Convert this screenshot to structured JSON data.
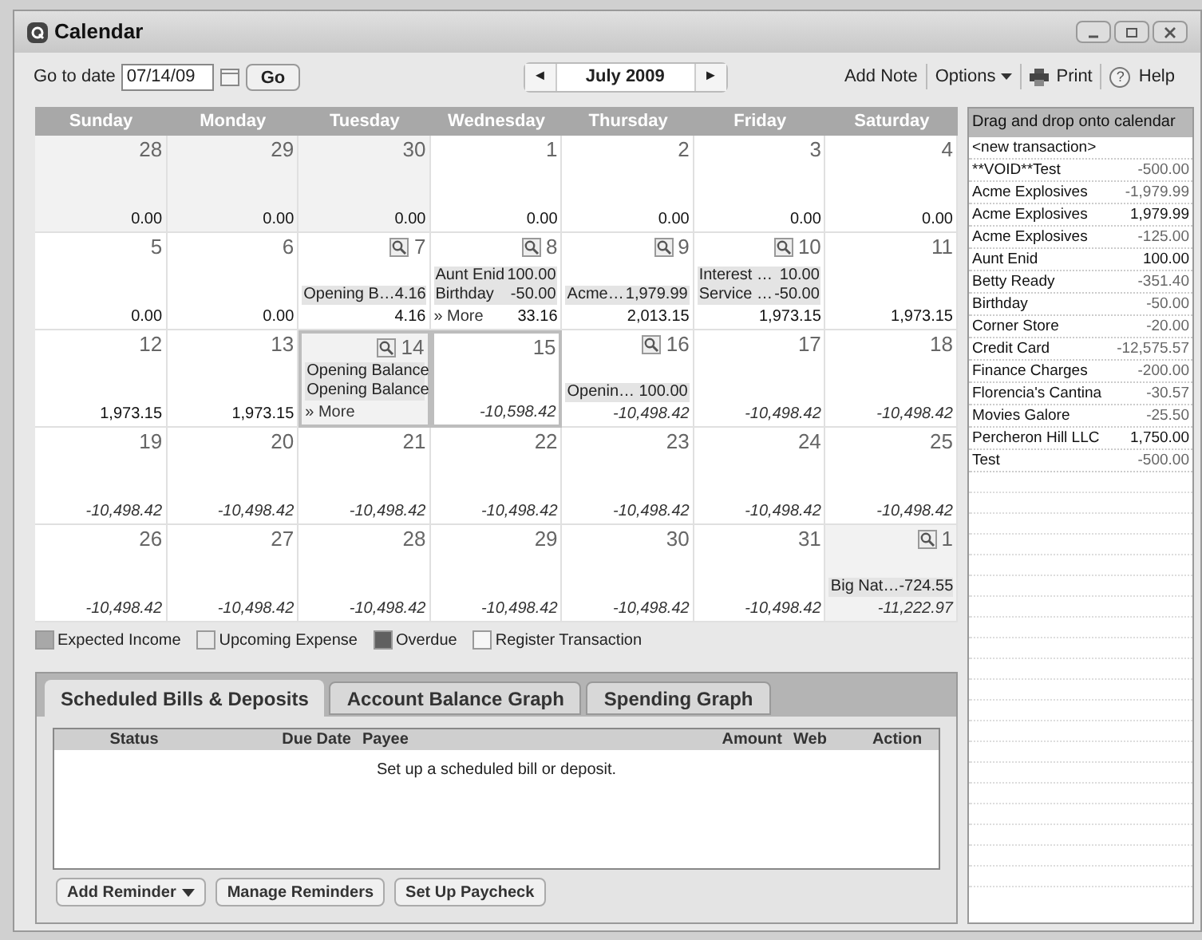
{
  "window": {
    "title": "Calendar"
  },
  "toolbar": {
    "goto_label": "Go to date",
    "goto_value": "07/14/09",
    "go_button": "Go",
    "prev": "◄",
    "month": "July 2009",
    "next": "►",
    "add_note": "Add Note",
    "options": "Options",
    "help_mark": "?",
    "print": "Print",
    "help": "Help"
  },
  "weekdays": [
    "Sunday",
    "Monday",
    "Tuesday",
    "Wednesday",
    "Thursday",
    "Friday",
    "Saturday"
  ],
  "weeks": [
    [
      {
        "day": "28",
        "shaded": true,
        "outlined": false,
        "zoom": false,
        "projected": false,
        "balance": "0.00"
      },
      {
        "day": "29",
        "shaded": true,
        "outlined": false,
        "zoom": false,
        "projected": false,
        "balance": "0.00"
      },
      {
        "day": "30",
        "shaded": true,
        "outlined": false,
        "zoom": false,
        "projected": false,
        "balance": "0.00"
      },
      {
        "day": "1",
        "shaded": false,
        "outlined": false,
        "zoom": false,
        "projected": false,
        "balance": "0.00"
      },
      {
        "day": "2",
        "shaded": false,
        "outlined": false,
        "zoom": false,
        "projected": false,
        "balance": "0.00"
      },
      {
        "day": "3",
        "shaded": false,
        "outlined": false,
        "zoom": false,
        "projected": false,
        "balance": "0.00"
      },
      {
        "day": "4",
        "shaded": false,
        "outlined": false,
        "zoom": false,
        "projected": false,
        "balance": "0.00"
      }
    ],
    [
      {
        "day": "5",
        "shaded": false,
        "outlined": false,
        "zoom": false,
        "projected": false,
        "balance": "0.00"
      },
      {
        "day": "6",
        "shaded": false,
        "outlined": false,
        "zoom": false,
        "projected": false,
        "balance": "0.00"
      },
      {
        "day": "7",
        "shaded": false,
        "outlined": false,
        "zoom": true,
        "projected": false,
        "entries": [
          {
            "label": "Opening B…",
            "amount": "4.16"
          }
        ],
        "balance": "4.16"
      },
      {
        "day": "8",
        "shaded": false,
        "outlined": false,
        "zoom": true,
        "projected": false,
        "entries": [
          {
            "label": "Aunt Enid",
            "amount": "100.00"
          },
          {
            "label": "Birthday",
            "amount": "-50.00"
          }
        ],
        "more": "» More",
        "balance": "33.16"
      },
      {
        "day": "9",
        "shaded": false,
        "outlined": false,
        "zoom": true,
        "projected": false,
        "entries": [
          {
            "label": "Acme…",
            "amount": "1,979.99"
          }
        ],
        "balance": "2,013.15"
      },
      {
        "day": "10",
        "shaded": false,
        "outlined": false,
        "zoom": true,
        "projected": false,
        "entries": [
          {
            "label": "Interest …",
            "amount": "10.00"
          },
          {
            "label": "Service …",
            "amount": "-50.00"
          }
        ],
        "balance": "1,973.15"
      },
      {
        "day": "11",
        "shaded": false,
        "outlined": false,
        "zoom": false,
        "projected": false,
        "balance": "1,973.15"
      }
    ],
    [
      {
        "day": "12",
        "shaded": false,
        "outlined": false,
        "zoom": false,
        "projected": false,
        "balance": "1,973.15"
      },
      {
        "day": "13",
        "shaded": false,
        "outlined": false,
        "zoom": false,
        "projected": false,
        "balance": "1,973.15"
      },
      {
        "day": "14",
        "shaded": true,
        "outlined": true,
        "zoom": true,
        "entries": [
          {
            "label": "Opening Balance"
          },
          {
            "label": "Opening Balance"
          }
        ],
        "more": "» More"
      },
      {
        "day": "15",
        "shaded": false,
        "outlined": true,
        "zoom": false,
        "projected": true,
        "balance": "-10,598.42"
      },
      {
        "day": "16",
        "shaded": false,
        "outlined": false,
        "zoom": true,
        "projected": true,
        "entries": [
          {
            "label": "Openin…",
            "amount": "100.00"
          }
        ],
        "balance": "-10,498.42"
      },
      {
        "day": "17",
        "shaded": false,
        "outlined": false,
        "zoom": false,
        "projected": true,
        "balance": "-10,498.42"
      },
      {
        "day": "18",
        "shaded": false,
        "outlined": false,
        "zoom": false,
        "projected": true,
        "balance": "-10,498.42"
      }
    ],
    [
      {
        "day": "19",
        "shaded": false,
        "outlined": false,
        "zoom": false,
        "projected": true,
        "balance": "-10,498.42"
      },
      {
        "day": "20",
        "shaded": false,
        "outlined": false,
        "zoom": false,
        "projected": true,
        "balance": "-10,498.42"
      },
      {
        "day": "21",
        "shaded": false,
        "outlined": false,
        "zoom": false,
        "projected": true,
        "balance": "-10,498.42"
      },
      {
        "day": "22",
        "shaded": false,
        "outlined": false,
        "zoom": false,
        "projected": true,
        "balance": "-10,498.42"
      },
      {
        "day": "23",
        "shaded": false,
        "outlined": false,
        "zoom": false,
        "projected": true,
        "balance": "-10,498.42"
      },
      {
        "day": "24",
        "shaded": false,
        "outlined": false,
        "zoom": false,
        "projected": true,
        "balance": "-10,498.42"
      },
      {
        "day": "25",
        "shaded": false,
        "outlined": false,
        "zoom": false,
        "projected": true,
        "balance": "-10,498.42"
      }
    ],
    [
      {
        "day": "26",
        "shaded": false,
        "outlined": false,
        "zoom": false,
        "projected": true,
        "balance": "-10,498.42"
      },
      {
        "day": "27",
        "shaded": false,
        "outlined": false,
        "zoom": false,
        "projected": true,
        "balance": "-10,498.42"
      },
      {
        "day": "28",
        "shaded": false,
        "outlined": false,
        "zoom": false,
        "projected": true,
        "balance": "-10,498.42"
      },
      {
        "day": "29",
        "shaded": false,
        "outlined": false,
        "zoom": false,
        "projected": true,
        "balance": "-10,498.42"
      },
      {
        "day": "30",
        "shaded": false,
        "outlined": false,
        "zoom": false,
        "projected": true,
        "balance": "-10,498.42"
      },
      {
        "day": "31",
        "shaded": false,
        "outlined": false,
        "zoom": false,
        "projected": true,
        "balance": "-10,498.42"
      },
      {
        "day": "1",
        "shaded": true,
        "outlined": false,
        "zoom": true,
        "projected": true,
        "entries": [
          {
            "label": "Big Nat…",
            "amount": "-724.55"
          }
        ],
        "balance": "-11,222.97"
      }
    ]
  ],
  "legend": [
    {
      "label": "Expected Income",
      "color": "#a8a8a8"
    },
    {
      "label": "Upcoming Expense",
      "color": "#e8e8e8"
    },
    {
      "label": "Overdue",
      "color": "#606060"
    },
    {
      "label": "Register Transaction",
      "color": "#f6f6f6"
    }
  ],
  "tabs": [
    {
      "label": "Scheduled Bills & Deposits",
      "selected": true
    },
    {
      "label": "Account Balance Graph",
      "selected": false
    },
    {
      "label": "Spending Graph",
      "selected": false
    }
  ],
  "table": {
    "columns": [
      "Status",
      "Due Date",
      "Payee",
      "Amount",
      "Web",
      "Action"
    ],
    "empty_message": "Set up a scheduled bill or deposit."
  },
  "buttons": [
    {
      "label": "Add Reminder",
      "menu": true
    },
    {
      "label": "Manage Reminders",
      "menu": false
    },
    {
      "label": "Set Up Paycheck",
      "menu": false
    }
  ],
  "sidebar": {
    "title": "Drag and drop onto calendar",
    "items": [
      {
        "name": "<new transaction>"
      },
      {
        "name": "**VOID**Test",
        "amount": "-500.00"
      },
      {
        "name": "Acme Explosives",
        "amount": "-1,979.99"
      },
      {
        "name": "Acme Explosives",
        "amount": "1,979.99"
      },
      {
        "name": "Acme Explosives",
        "amount": "-125.00"
      },
      {
        "name": "Aunt Enid",
        "amount": "100.00"
      },
      {
        "name": "Betty Ready",
        "amount": "-351.40"
      },
      {
        "name": "Birthday",
        "amount": "-50.00"
      },
      {
        "name": "Corner Store",
        "amount": "-20.00"
      },
      {
        "name": "Credit Card",
        "amount": "-12,575.57"
      },
      {
        "name": "Finance Charges",
        "amount": "-200.00"
      },
      {
        "name": "Florencia's Cantina",
        "amount": "-30.57"
      },
      {
        "name": "Movies Galore",
        "amount": "-25.50"
      },
      {
        "name": "Percheron Hill LLC",
        "amount": "1,750.00"
      },
      {
        "name": "Test",
        "amount": "-500.00"
      }
    ]
  }
}
